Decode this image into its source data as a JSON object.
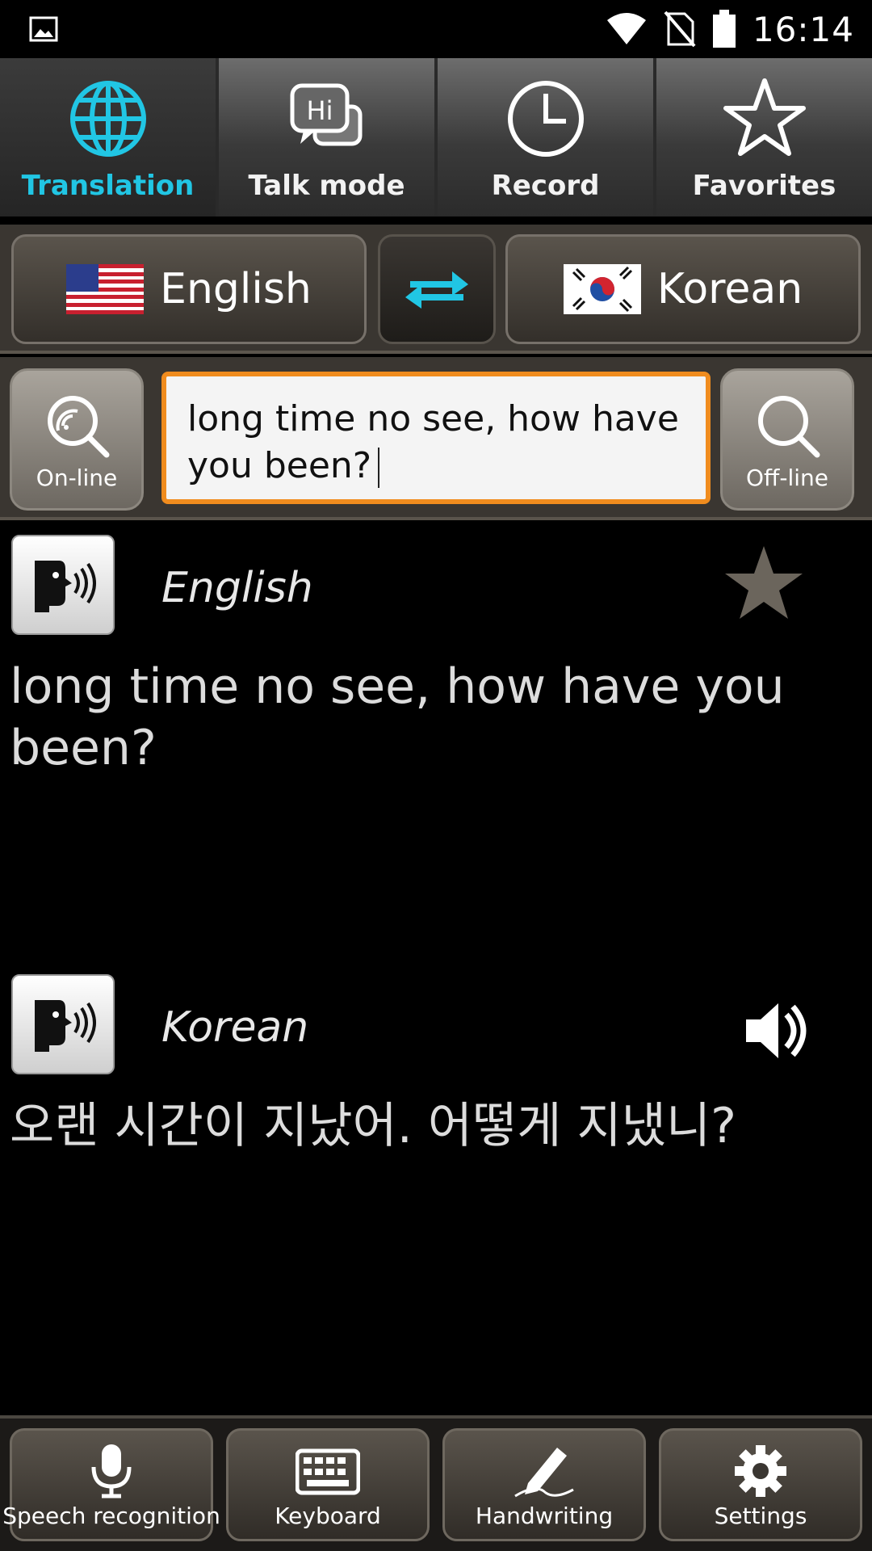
{
  "status_bar": {
    "time": "16:14",
    "left_icon": "image-icon",
    "right_icons": [
      "wifi-icon",
      "no-sim-icon",
      "battery-icon"
    ]
  },
  "tabs": [
    {
      "label": "Translation",
      "icon": "globe-icon",
      "active": true
    },
    {
      "label": "Talk mode",
      "icon": "chat-bubbles-icon",
      "active": false
    },
    {
      "label": "Record",
      "icon": "clock-icon",
      "active": false
    },
    {
      "label": "Favorites",
      "icon": "star-icon",
      "active": false
    }
  ],
  "language_bar": {
    "source": {
      "label": "English",
      "flag": "us-flag"
    },
    "target": {
      "label": "Korean",
      "flag": "kr-flag"
    },
    "swap_icon": "swap-arrows-icon"
  },
  "input_row": {
    "online_label": "On-line",
    "offline_label": "Off-line",
    "input_value": "long time no see, how have you been?"
  },
  "results": {
    "source": {
      "language": "English",
      "text": "long time no see, how have you been?"
    },
    "target": {
      "language": "Korean",
      "text": "오랜 시간이 지났어. 어떻게 지냈니?"
    }
  },
  "bottom_bar": [
    {
      "label": "Speech recognition",
      "icon": "microphone-icon"
    },
    {
      "label": "Keyboard",
      "icon": "keyboard-icon"
    },
    {
      "label": "Handwriting",
      "icon": "pen-icon"
    },
    {
      "label": "Settings",
      "icon": "gear-icon"
    }
  ],
  "colors": {
    "accent": "#21c6e4",
    "input_border": "#f08c1e",
    "background": "#000000"
  }
}
